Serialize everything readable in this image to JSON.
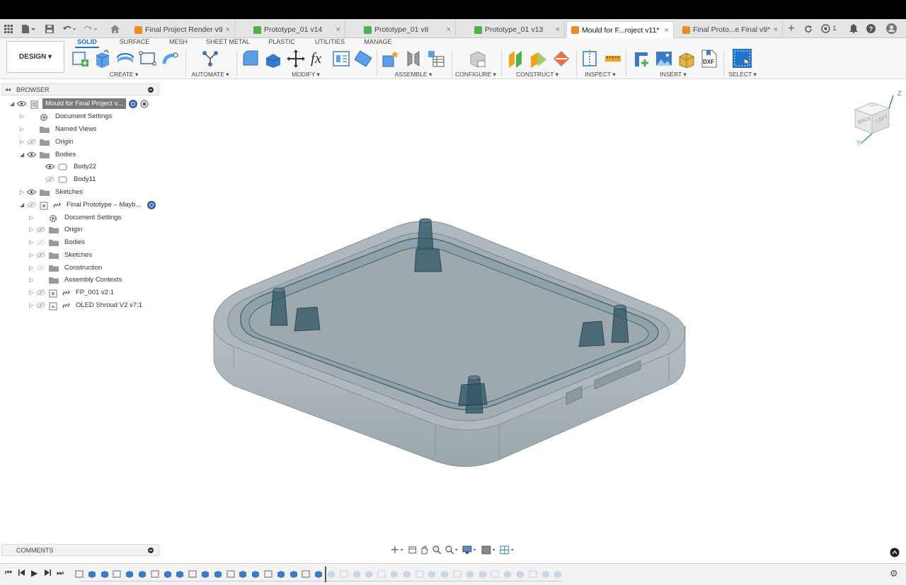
{
  "tabs": [
    {
      "label": "Final Project Render v9",
      "icon_color": "#f08a24",
      "active": false
    },
    {
      "label": "Prototype_01 v14",
      "icon_color": "#4caf50",
      "active": false
    },
    {
      "label": "Prototype_01 v8",
      "icon_color": "#4caf50",
      "active": false
    },
    {
      "label": "Prototype_01 v13",
      "icon_color": "#4caf50",
      "active": false
    },
    {
      "label": "Mould for F...roject v11*",
      "icon_color": "#f08a24",
      "active": true
    },
    {
      "label": "Final Proto...e Final v9*",
      "icon_color": "#f08a24",
      "active": false
    }
  ],
  "tab_close": "×",
  "tab_new": "+",
  "status": {
    "jobs_count": "1"
  },
  "workspace": {
    "label": "DESIGN ▾"
  },
  "ribbon_tabs": [
    "SOLID",
    "SURFACE",
    "MESH",
    "SHEET METAL",
    "PLASTIC",
    "UTILITIES",
    "MANAGE"
  ],
  "ribbon_groups": {
    "create": "CREATE ▾",
    "automate": "AUTOMATE ▾",
    "modify": "MODIFY ▾",
    "assemble": "ASSEMBLE ▾",
    "configure": "CONFIGURE ▾",
    "construct": "CONSTRUCT ▾",
    "inspect": "INSPECT ▾",
    "insert": "INSERT ▾",
    "select": "SELECT ▾"
  },
  "insert_dxf": "DXF",
  "modify_fx": "fx",
  "browser": {
    "title": "BROWSER",
    "collapse": "◂◂",
    "items": [
      {
        "label": "Mould for Final Project v...",
        "triangle": "◢",
        "highlight": true
      },
      {
        "label": "Document Settings",
        "triangle": "▷"
      },
      {
        "label": "Named Views",
        "triangle": "▷"
      },
      {
        "label": "Origin",
        "triangle": "▷"
      },
      {
        "label": "Bodies",
        "triangle": "◢"
      },
      {
        "label": "Body22",
        "triangle": ""
      },
      {
        "label": "Body11",
        "triangle": ""
      },
      {
        "label": "Sketches",
        "triangle": "▷"
      },
      {
        "label": "Final Prototype – Mayb...",
        "triangle": "◢"
      },
      {
        "label": "Document Settings",
        "triangle": "▷"
      },
      {
        "label": "Origin",
        "triangle": "▷"
      },
      {
        "label": "Bodies",
        "triangle": "▷"
      },
      {
        "label": "Sketches",
        "triangle": "▷"
      },
      {
        "label": "Construction",
        "triangle": "▷"
      },
      {
        "label": "Assembly Contexts",
        "triangle": "▷"
      },
      {
        "label": "FP_001 v2:1",
        "triangle": "▷"
      },
      {
        "label": "OLED Shroud V2 v7:1",
        "triangle": "▷"
      }
    ]
  },
  "comments": {
    "title": "COMMENTS"
  },
  "viewcube": {
    "back": "BACK",
    "left": "LEFT",
    "top": "TOP",
    "axis_z": "Z",
    "axis_y": "Y"
  },
  "timeline": {
    "first": "⏮",
    "prev": "◀",
    "play": "▶",
    "next": "▶",
    "last": "⏭",
    "settings": "⚙"
  },
  "colors": {
    "accent": "#1f74c8",
    "model_fill": "#9aa6ad",
    "model_edge": "#3f5a66",
    "bosses": "#2f5563",
    "highlight_row": "#7a7a7a"
  }
}
